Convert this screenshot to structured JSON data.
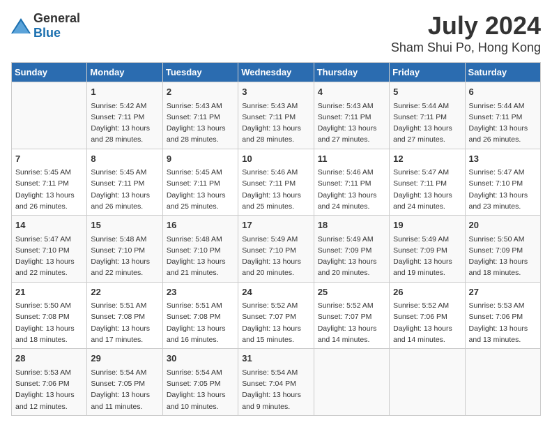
{
  "logo": {
    "general": "General",
    "blue": "Blue"
  },
  "title": "July 2024",
  "subtitle": "Sham Shui Po, Hong Kong",
  "days_of_week": [
    "Sunday",
    "Monday",
    "Tuesday",
    "Wednesday",
    "Thursday",
    "Friday",
    "Saturday"
  ],
  "weeks": [
    [
      {
        "day": "",
        "info": ""
      },
      {
        "day": "1",
        "info": "Sunrise: 5:42 AM\nSunset: 7:11 PM\nDaylight: 13 hours\nand 28 minutes."
      },
      {
        "day": "2",
        "info": "Sunrise: 5:43 AM\nSunset: 7:11 PM\nDaylight: 13 hours\nand 28 minutes."
      },
      {
        "day": "3",
        "info": "Sunrise: 5:43 AM\nSunset: 7:11 PM\nDaylight: 13 hours\nand 28 minutes."
      },
      {
        "day": "4",
        "info": "Sunrise: 5:43 AM\nSunset: 7:11 PM\nDaylight: 13 hours\nand 27 minutes."
      },
      {
        "day": "5",
        "info": "Sunrise: 5:44 AM\nSunset: 7:11 PM\nDaylight: 13 hours\nand 27 minutes."
      },
      {
        "day": "6",
        "info": "Sunrise: 5:44 AM\nSunset: 7:11 PM\nDaylight: 13 hours\nand 26 minutes."
      }
    ],
    [
      {
        "day": "7",
        "info": "Sunrise: 5:45 AM\nSunset: 7:11 PM\nDaylight: 13 hours\nand 26 minutes."
      },
      {
        "day": "8",
        "info": "Sunrise: 5:45 AM\nSunset: 7:11 PM\nDaylight: 13 hours\nand 26 minutes."
      },
      {
        "day": "9",
        "info": "Sunrise: 5:45 AM\nSunset: 7:11 PM\nDaylight: 13 hours\nand 25 minutes."
      },
      {
        "day": "10",
        "info": "Sunrise: 5:46 AM\nSunset: 7:11 PM\nDaylight: 13 hours\nand 25 minutes."
      },
      {
        "day": "11",
        "info": "Sunrise: 5:46 AM\nSunset: 7:11 PM\nDaylight: 13 hours\nand 24 minutes."
      },
      {
        "day": "12",
        "info": "Sunrise: 5:47 AM\nSunset: 7:11 PM\nDaylight: 13 hours\nand 24 minutes."
      },
      {
        "day": "13",
        "info": "Sunrise: 5:47 AM\nSunset: 7:10 PM\nDaylight: 13 hours\nand 23 minutes."
      }
    ],
    [
      {
        "day": "14",
        "info": "Sunrise: 5:47 AM\nSunset: 7:10 PM\nDaylight: 13 hours\nand 22 minutes."
      },
      {
        "day": "15",
        "info": "Sunrise: 5:48 AM\nSunset: 7:10 PM\nDaylight: 13 hours\nand 22 minutes."
      },
      {
        "day": "16",
        "info": "Sunrise: 5:48 AM\nSunset: 7:10 PM\nDaylight: 13 hours\nand 21 minutes."
      },
      {
        "day": "17",
        "info": "Sunrise: 5:49 AM\nSunset: 7:10 PM\nDaylight: 13 hours\nand 20 minutes."
      },
      {
        "day": "18",
        "info": "Sunrise: 5:49 AM\nSunset: 7:09 PM\nDaylight: 13 hours\nand 20 minutes."
      },
      {
        "day": "19",
        "info": "Sunrise: 5:49 AM\nSunset: 7:09 PM\nDaylight: 13 hours\nand 19 minutes."
      },
      {
        "day": "20",
        "info": "Sunrise: 5:50 AM\nSunset: 7:09 PM\nDaylight: 13 hours\nand 18 minutes."
      }
    ],
    [
      {
        "day": "21",
        "info": "Sunrise: 5:50 AM\nSunset: 7:08 PM\nDaylight: 13 hours\nand 18 minutes."
      },
      {
        "day": "22",
        "info": "Sunrise: 5:51 AM\nSunset: 7:08 PM\nDaylight: 13 hours\nand 17 minutes."
      },
      {
        "day": "23",
        "info": "Sunrise: 5:51 AM\nSunset: 7:08 PM\nDaylight: 13 hours\nand 16 minutes."
      },
      {
        "day": "24",
        "info": "Sunrise: 5:52 AM\nSunset: 7:07 PM\nDaylight: 13 hours\nand 15 minutes."
      },
      {
        "day": "25",
        "info": "Sunrise: 5:52 AM\nSunset: 7:07 PM\nDaylight: 13 hours\nand 14 minutes."
      },
      {
        "day": "26",
        "info": "Sunrise: 5:52 AM\nSunset: 7:06 PM\nDaylight: 13 hours\nand 14 minutes."
      },
      {
        "day": "27",
        "info": "Sunrise: 5:53 AM\nSunset: 7:06 PM\nDaylight: 13 hours\nand 13 minutes."
      }
    ],
    [
      {
        "day": "28",
        "info": "Sunrise: 5:53 AM\nSunset: 7:06 PM\nDaylight: 13 hours\nand 12 minutes."
      },
      {
        "day": "29",
        "info": "Sunrise: 5:54 AM\nSunset: 7:05 PM\nDaylight: 13 hours\nand 11 minutes."
      },
      {
        "day": "30",
        "info": "Sunrise: 5:54 AM\nSunset: 7:05 PM\nDaylight: 13 hours\nand 10 minutes."
      },
      {
        "day": "31",
        "info": "Sunrise: 5:54 AM\nSunset: 7:04 PM\nDaylight: 13 hours\nand 9 minutes."
      },
      {
        "day": "",
        "info": ""
      },
      {
        "day": "",
        "info": ""
      },
      {
        "day": "",
        "info": ""
      }
    ]
  ]
}
